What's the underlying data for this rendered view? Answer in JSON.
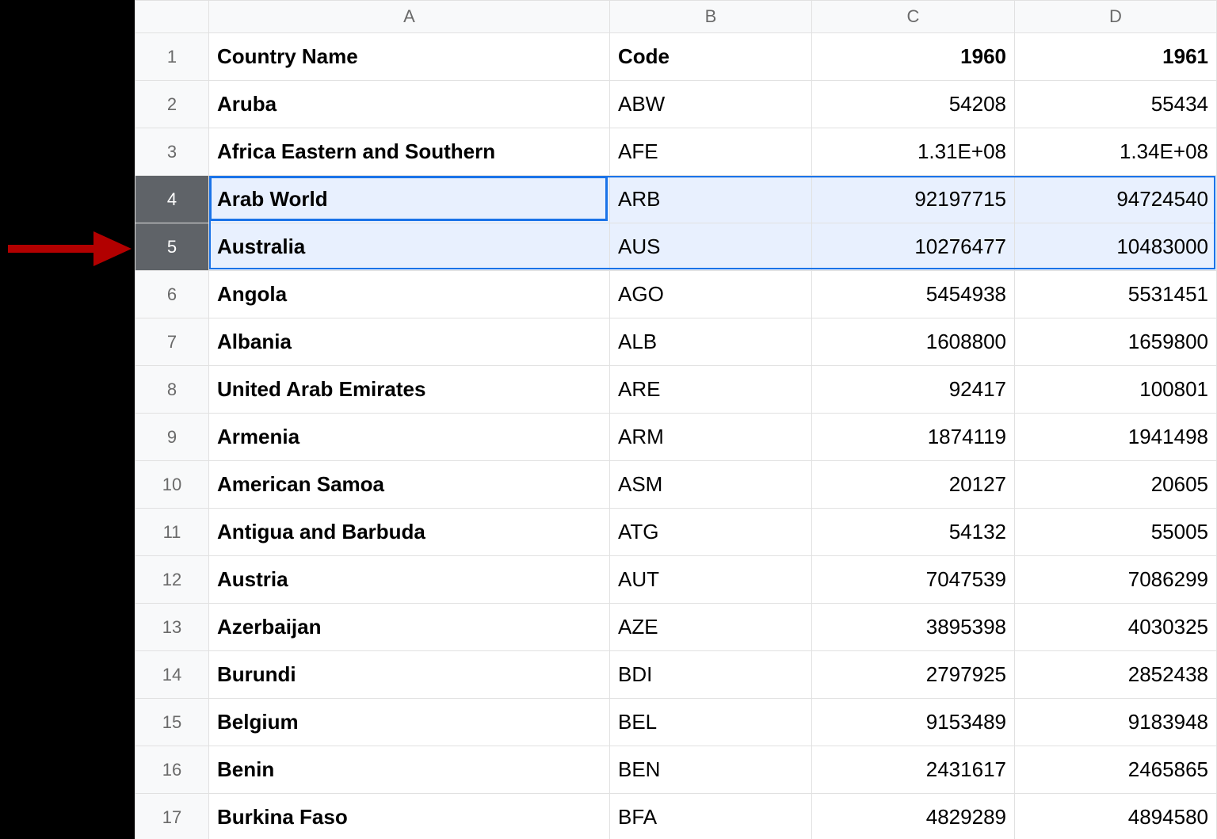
{
  "columns": {
    "A": "A",
    "B": "B",
    "C": "C",
    "D": "D"
  },
  "headerRow": {
    "countryName": "Country Name",
    "code": "Code",
    "y1960": "1960",
    "y1961": "1961"
  },
  "rowNumbers": [
    "1",
    "2",
    "3",
    "4",
    "5",
    "6",
    "7",
    "8",
    "9",
    "10",
    "11",
    "12",
    "13",
    "14",
    "15",
    "16",
    "17"
  ],
  "rows": [
    {
      "name": "Aruba",
      "code": "ABW",
      "c": "54208",
      "d": "55434",
      "bold": true
    },
    {
      "name": "Africa Eastern and Southern",
      "code": "AFE",
      "c": "1.31E+08",
      "d": "1.34E+08",
      "bold": true
    },
    {
      "name": "Arab World",
      "code": "ARB",
      "c": "92197715",
      "d": "94724540",
      "bold": true
    },
    {
      "name": "Australia",
      "code": "AUS",
      "c": "10276477",
      "d": "10483000",
      "bold": true
    },
    {
      "name": "Angola",
      "code": "AGO",
      "c": "5454938",
      "d": "5531451",
      "bold": true
    },
    {
      "name": "Albania",
      "code": "ALB",
      "c": "1608800",
      "d": "1659800",
      "bold": true
    },
    {
      "name": "United Arab Emirates",
      "code": "ARE",
      "c": "92417",
      "d": "100801",
      "bold": true
    },
    {
      "name": "Armenia",
      "code": "ARM",
      "c": "1874119",
      "d": "1941498",
      "bold": true
    },
    {
      "name": "American Samoa",
      "code": "ASM",
      "c": "20127",
      "d": "20605",
      "bold": true
    },
    {
      "name": "Antigua and Barbuda",
      "code": "ATG",
      "c": "54132",
      "d": "55005",
      "bold": true
    },
    {
      "name": "Austria",
      "code": "AUT",
      "c": "7047539",
      "d": "7086299",
      "bold": true
    },
    {
      "name": "Azerbaijan",
      "code": "AZE",
      "c": "3895398",
      "d": "4030325",
      "bold": true
    },
    {
      "name": "Burundi",
      "code": "BDI",
      "c": "2797925",
      "d": "2852438",
      "bold": true
    },
    {
      "name": "Belgium",
      "code": "BEL",
      "c": "9153489",
      "d": "9183948",
      "bold": true
    },
    {
      "name": "Benin",
      "code": "BEN",
      "c": "2431617",
      "d": "2465865",
      "bold": true
    },
    {
      "name": "Burkina Faso",
      "code": "BFA",
      "c": "4829289",
      "d": "4894580",
      "bold": true
    }
  ],
  "selection": {
    "selectedRowIndexes": [
      3,
      4
    ],
    "activeCellRow": 3,
    "activeCellCol": "A"
  },
  "annotation": {
    "arrowPointsToRow": 4
  }
}
